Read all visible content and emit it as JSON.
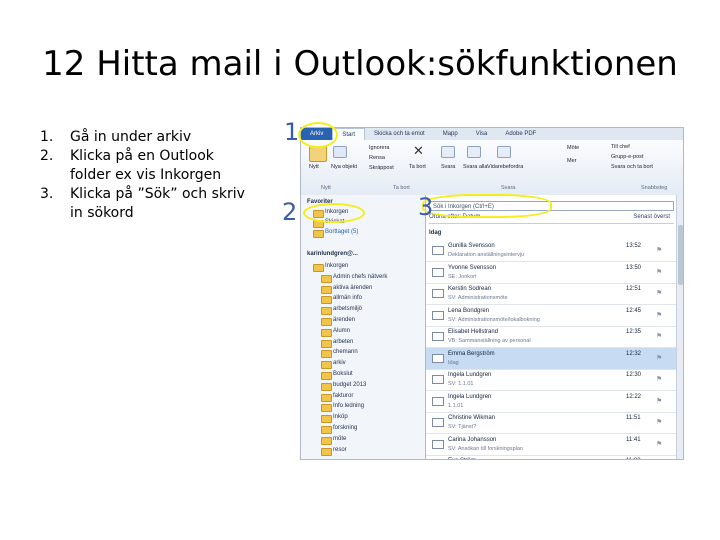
{
  "slide": {
    "title": "12 Hitta mail i Outlook:sökfunktionen",
    "steps": [
      {
        "num": "1.",
        "text": "Gå in under arkiv"
      },
      {
        "num": "2.",
        "text": "Klicka på en Outlook folder ex vis Inkorgen"
      },
      {
        "num": "3.",
        "text": "Klicka på ”Sök” och skriv in sökord"
      }
    ]
  },
  "annotations": {
    "one": "1",
    "two": "2",
    "three": "3"
  },
  "outlook": {
    "tabs": [
      "Arkiv",
      "Start",
      "Skicka och ta emot",
      "Mapp",
      "Visa",
      "Adobe PDF"
    ],
    "ribbon": {
      "new_email": "Nytt",
      "new_items": "Nya objekt",
      "ignore": "Ignorera",
      "clean": "Rensa",
      "junk": "Skräppost",
      "delete": "Ta bort",
      "reply": "Svara",
      "reply_all": "Svara alla",
      "forward": "Vidarebefordra",
      "meeting": "Möte",
      "more": "Mer",
      "to_manager": "Till chef",
      "team_email": "Grupp-e-post",
      "reply_delete": "Svara och ta bort",
      "group_new": "Nytt",
      "group_delete": "Ta bort",
      "group_respond": "Svara",
      "group_quick": "Snabbsteg"
    },
    "nav": {
      "favorites": "Favoriter",
      "inbox": "Inkorgen",
      "sent": "Skickat",
      "deleted": "Borttaget (5)",
      "mailbox": "karinlundgren@...",
      "folders": [
        "Inkorgen",
        "Admin chefs nätverk",
        "aktiva ärenden",
        "allmän info",
        "arbetsmiljö",
        "ärenden",
        "Alumn",
        "arbeten",
        "chemann",
        "arkiv",
        "Bokslut",
        "budget 2013",
        "fakturor",
        "Info ledning",
        "Inköp",
        "forskning",
        "möte",
        "resor"
      ]
    },
    "search_placeholder": "Sök i Inkorgen (Ctrl+E)",
    "list_header_sort": "Ordna efter: Datum",
    "list_header_order": "Senast överst",
    "group_today": "Idag",
    "emails": [
      {
        "sender": "Gunilla Svensson",
        "subject": "Deklaration anställningsintervju",
        "time": "13:52"
      },
      {
        "sender": "Yvonne Svensson",
        "subject": "SE: Jonkort",
        "time": "13:50"
      },
      {
        "sender": "Kerstin Sodrean",
        "subject": "SV: Administrationsmöte",
        "time": "12:51"
      },
      {
        "sender": "Lena Bondgren",
        "subject": "SV: Administrationsmöte/lokalbokning",
        "time": "12:45"
      },
      {
        "sender": "Elisabet Hellstrand",
        "subject": "VB: Sammanställning av personal",
        "time": "12:35"
      },
      {
        "sender": "Emma Bergström",
        "subject": "Idag",
        "time": "12:32"
      },
      {
        "sender": "Ingela Lundgren",
        "subject": "SV: 1.1.01",
        "time": "12:30"
      },
      {
        "sender": "Ingela Lundgren",
        "subject": "1.1.01",
        "time": "12:22"
      },
      {
        "sender": "Christine Wikman",
        "subject": "SV: Tjänst?",
        "time": "11:51"
      },
      {
        "sender": "Carina Johansson",
        "subject": "SV: Ansökan till forskningsplan",
        "time": "11:41"
      },
      {
        "sender": "Eva Ström",
        "subject": "",
        "time": "11:02"
      }
    ],
    "colors": {
      "highlight": "#f4ef1c",
      "file_tab": "#2a62b2",
      "selected_row": "#c7dcf3"
    }
  }
}
